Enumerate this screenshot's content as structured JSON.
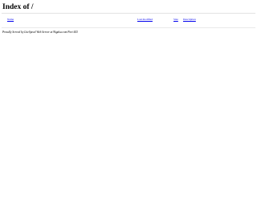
{
  "page": {
    "title": "Index of /"
  },
  "listing": {
    "columns": {
      "name": "Name",
      "last_modified": "Last modified",
      "size": "Size",
      "description": "Description"
    }
  },
  "footer": {
    "text": "Proudly Served by LiteSpeed Web Server at 9kgdsa.com Port 443"
  },
  "colors": {
    "link": "#0000ee",
    "text": "#000000",
    "rule": "#e3e3e3",
    "background": "#ffffff"
  }
}
